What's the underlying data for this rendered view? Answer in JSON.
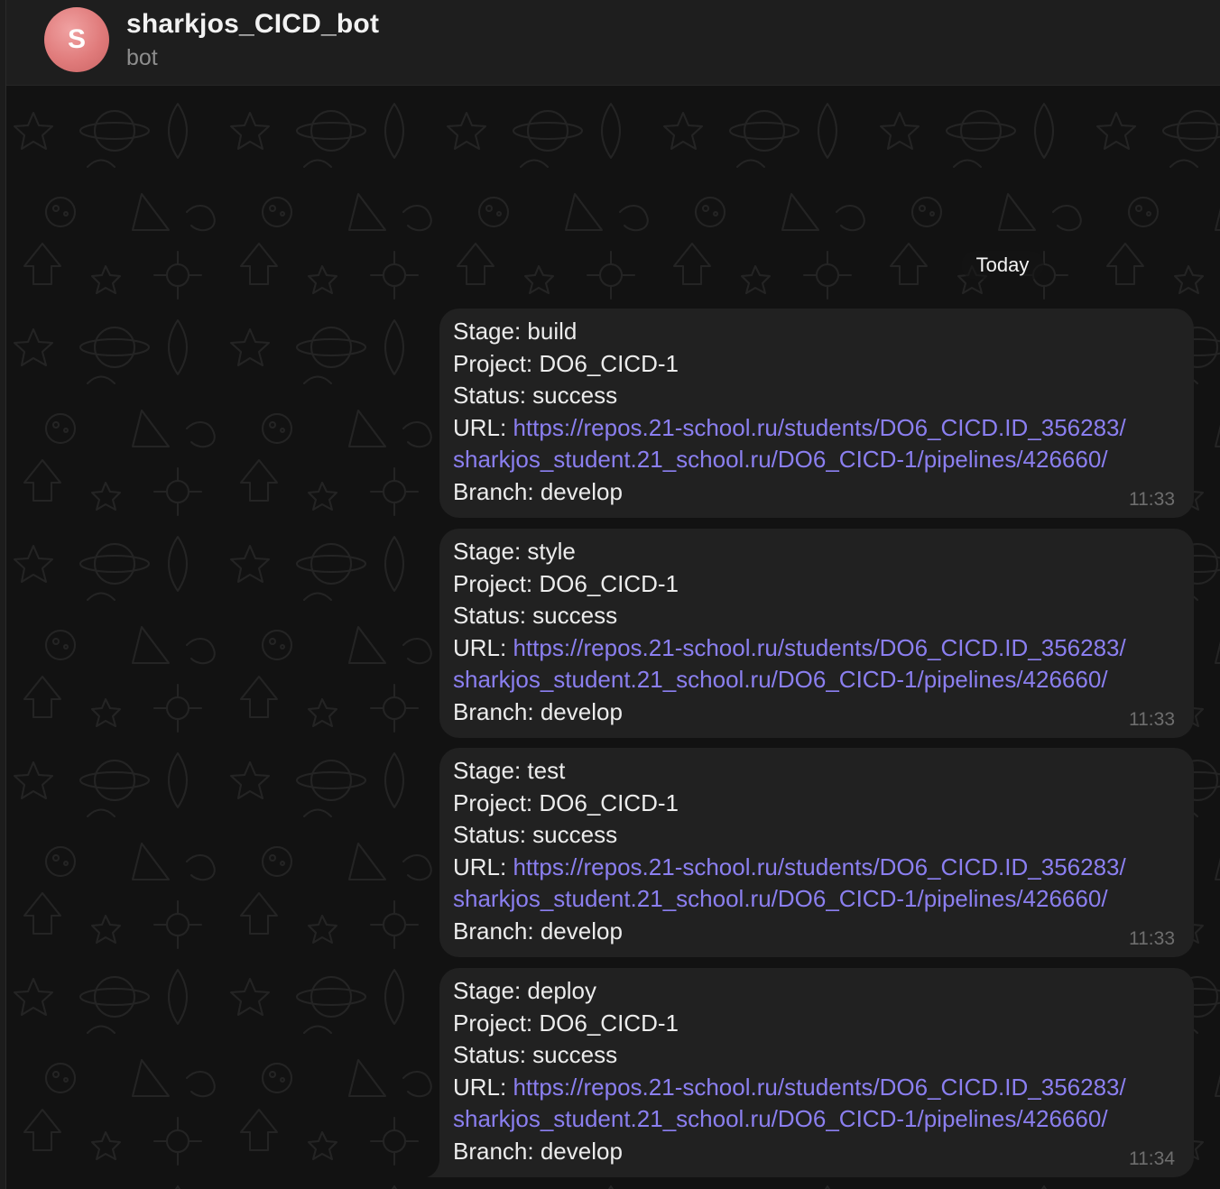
{
  "header": {
    "avatar_letter": "S",
    "title": "sharkjos_CICD_bot",
    "subtitle": "bot"
  },
  "chat": {
    "date_label": "Today",
    "messages": [
      {
        "stage": "Stage: build",
        "project": "Project: DO6_CICD-1",
        "status": "Status: success",
        "url_label": "URL: ",
        "url_line1": "https://repos.21-school.ru/students/DO6_CICD.ID_356283/",
        "url_line2": "sharkjos_student.21_school.ru/DO6_CICD-1/pipelines/426660/",
        "branch": "Branch: develop",
        "time": "11:33"
      },
      {
        "stage": "Stage: style",
        "project": "Project: DO6_CICD-1",
        "status": "Status: success",
        "url_label": "URL: ",
        "url_line1": "https://repos.21-school.ru/students/DO6_CICD.ID_356283/",
        "url_line2": "sharkjos_student.21_school.ru/DO6_CICD-1/pipelines/426660/",
        "branch": "Branch: develop",
        "time": "11:33"
      },
      {
        "stage": "Stage: test",
        "project": "Project: DO6_CICD-1",
        "status": "Status: success",
        "url_label": "URL: ",
        "url_line1": "https://repos.21-school.ru/students/DO6_CICD.ID_356283/",
        "url_line2": "sharkjos_student.21_school.ru/DO6_CICD-1/pipelines/426660/",
        "branch": "Branch: develop",
        "time": "11:33"
      },
      {
        "stage": "Stage: deploy",
        "project": "Project: DO6_CICD-1",
        "status": "Status: success",
        "url_label": "URL: ",
        "url_line1": "https://repos.21-school.ru/students/DO6_CICD.ID_356283/",
        "url_line2": "sharkjos_student.21_school.ru/DO6_CICD-1/pipelines/426660/",
        "branch": "Branch: develop",
        "time": "11:34"
      }
    ]
  },
  "colors": {
    "link": "#8b7ff0",
    "bubble": "#212121",
    "avatar": "#e07b7b"
  }
}
